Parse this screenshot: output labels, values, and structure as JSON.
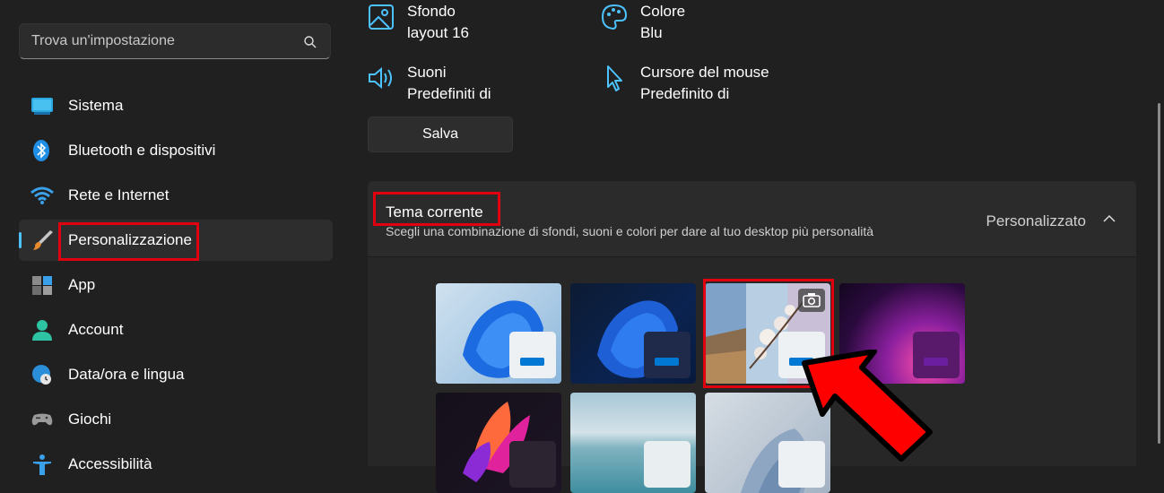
{
  "search": {
    "placeholder": "Trova un'impostazione"
  },
  "sidebar": {
    "items": [
      {
        "label": "Sistema"
      },
      {
        "label": "Bluetooth e dispositivi"
      },
      {
        "label": "Rete e Internet"
      },
      {
        "label": "Personalizzazione",
        "active": true
      },
      {
        "label": "App"
      },
      {
        "label": "Account"
      },
      {
        "label": "Data/ora e lingua"
      },
      {
        "label": "Giochi"
      },
      {
        "label": "Accessibilità"
      }
    ]
  },
  "quick": {
    "background": {
      "title": "Sfondo",
      "value": "layout 16"
    },
    "color": {
      "title": "Colore",
      "value": "Blu"
    },
    "sounds": {
      "title": "Suoni",
      "value": "Predefiniti di"
    },
    "cursor": {
      "title": "Cursore del mouse",
      "value": "Predefinito di"
    }
  },
  "save_label": "Salva",
  "theme": {
    "title": "Tema corrente",
    "subtitle": "Scegli una combinazione di sfondi, suoni e colori per dare al tuo desktop più personalità",
    "value": "Personalizzato",
    "themes": [
      {
        "name": "windows-light",
        "accent": "#0078d4"
      },
      {
        "name": "windows-dark",
        "accent": "#0078d4"
      },
      {
        "name": "custom-photo",
        "accent": "#0078d4",
        "selected": true
      },
      {
        "name": "glow",
        "accent": "#6b1fa0"
      },
      {
        "name": "captured-motion"
      },
      {
        "name": "flow"
      },
      {
        "name": "sunrise"
      }
    ]
  },
  "colors": {
    "accent": "#4cc2ff",
    "highlight": "#e0000f"
  }
}
